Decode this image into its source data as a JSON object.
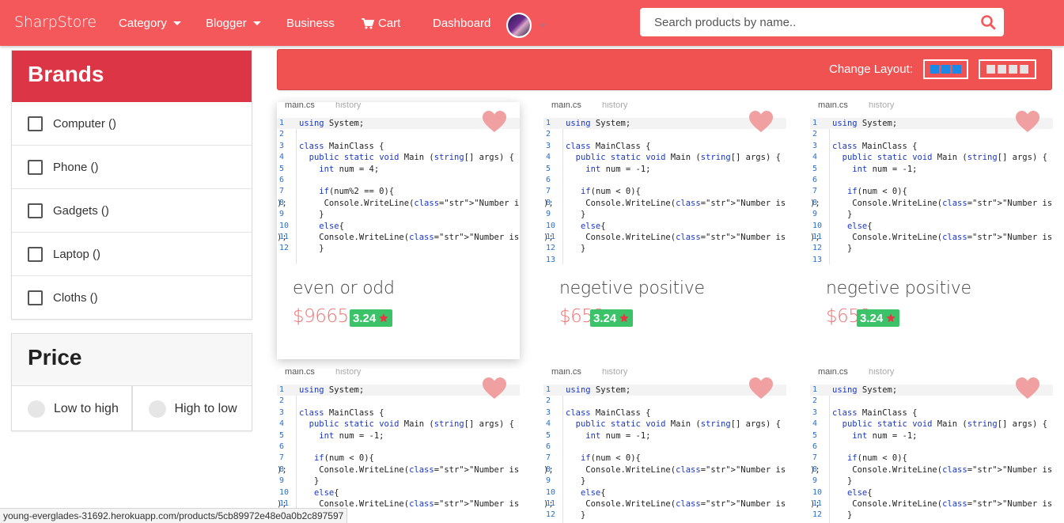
{
  "nav": {
    "brand": "SharpStore",
    "items": [
      {
        "label": "Category",
        "dropdown": true
      },
      {
        "label": "Blogger",
        "dropdown": true
      },
      {
        "label": "Business",
        "dropdown": false
      },
      {
        "label": "Cart",
        "dropdown": false,
        "icon": "cart-icon"
      },
      {
        "label": "Dashboard",
        "dropdown": false
      }
    ],
    "search_placeholder": "Search products by name..",
    "accent": "#f5585a"
  },
  "sidebar": {
    "brands_title": "Brands",
    "brands": [
      "Computer ()",
      "Phone ()",
      "Gadgets ()",
      "Laptop ()",
      "Cloths ()"
    ],
    "price_title": "Price",
    "price_options": [
      "Low to high",
      "High to low"
    ]
  },
  "layout_bar": {
    "label": "Change Layout:"
  },
  "code_tabs": {
    "main": "main.cs",
    "history": "history"
  },
  "products": [
    {
      "title": "even or odd",
      "price": "$9665",
      "rating": "3.24",
      "code": [
        "using System;",
        "",
        "class MainClass {",
        "  public static void Main (string[] args) {",
        "    int num = 4;",
        "",
        "    if(num%2 == 0){",
        "     Console.WriteLine(\"Number is even\");",
        "    }",
        "    else{",
        "    Console.WriteLine(\"Number is odd\");",
        "    }"
      ]
    },
    {
      "title": "negetive positive",
      "price": "$658",
      "rating": "3.24",
      "code": [
        "using System;",
        "",
        "class MainClass {",
        "  public static void Main (string[] args) {",
        "    int num = -1;",
        "",
        "   if(num < 0){",
        "    Console.WriteLine(\"Number is Negitive\");",
        "   }",
        "   else{",
        "    Console.WriteLine(\"Number is Positive\");",
        "   }",
        ""
      ]
    },
    {
      "title": "negetive positive",
      "price": "$658",
      "rating": "3.24",
      "code": [
        "using System;",
        "",
        "class MainClass {",
        "  public static void Main (string[] args) {",
        "    int num = -1;",
        "",
        "   if(num < 0){",
        "    Console.WriteLine(\"Number is Negitive\");",
        "   }",
        "   else{",
        "    Console.WriteLine(\"Number is Positive\");",
        "   }",
        ""
      ]
    },
    {
      "title": "",
      "price": "",
      "rating": "",
      "code": [
        "using System;",
        "",
        "class MainClass {",
        "  public static void Main (string[] args) {",
        "    int num = -1;",
        "",
        "   if(num < 0){",
        "    Console.WriteLine(\"Number is Negitive\");",
        "   }",
        "   else{",
        "    Console.WriteLine(\"Number is Positive\");",
        "   }"
      ]
    },
    {
      "title": "",
      "price": "",
      "rating": "",
      "code": [
        "using System;",
        "",
        "class MainClass {",
        "  public static void Main (string[] args) {",
        "    int num = -1;",
        "",
        "   if(num < 0){",
        "    Console.WriteLine(\"Number is Negitive\");",
        "   }",
        "   else{",
        "    Console.WriteLine(\"Number is Positive\");",
        "   }"
      ]
    },
    {
      "title": "",
      "price": "",
      "rating": "",
      "code": [
        "using System;",
        "",
        "class MainClass {",
        "  public static void Main (string[] args) {",
        "    int num = -1;",
        "",
        "   if(num < 0){",
        "    Console.WriteLine(\"Number is Negitive\");",
        "   }",
        "   else{",
        "    Console.WriteLine(\"Number is Positive\");",
        "   }"
      ]
    }
  ],
  "status_url": "young-everglades-31692.herokuapp.com/products/5cb89972e48e0a0b2c897597"
}
